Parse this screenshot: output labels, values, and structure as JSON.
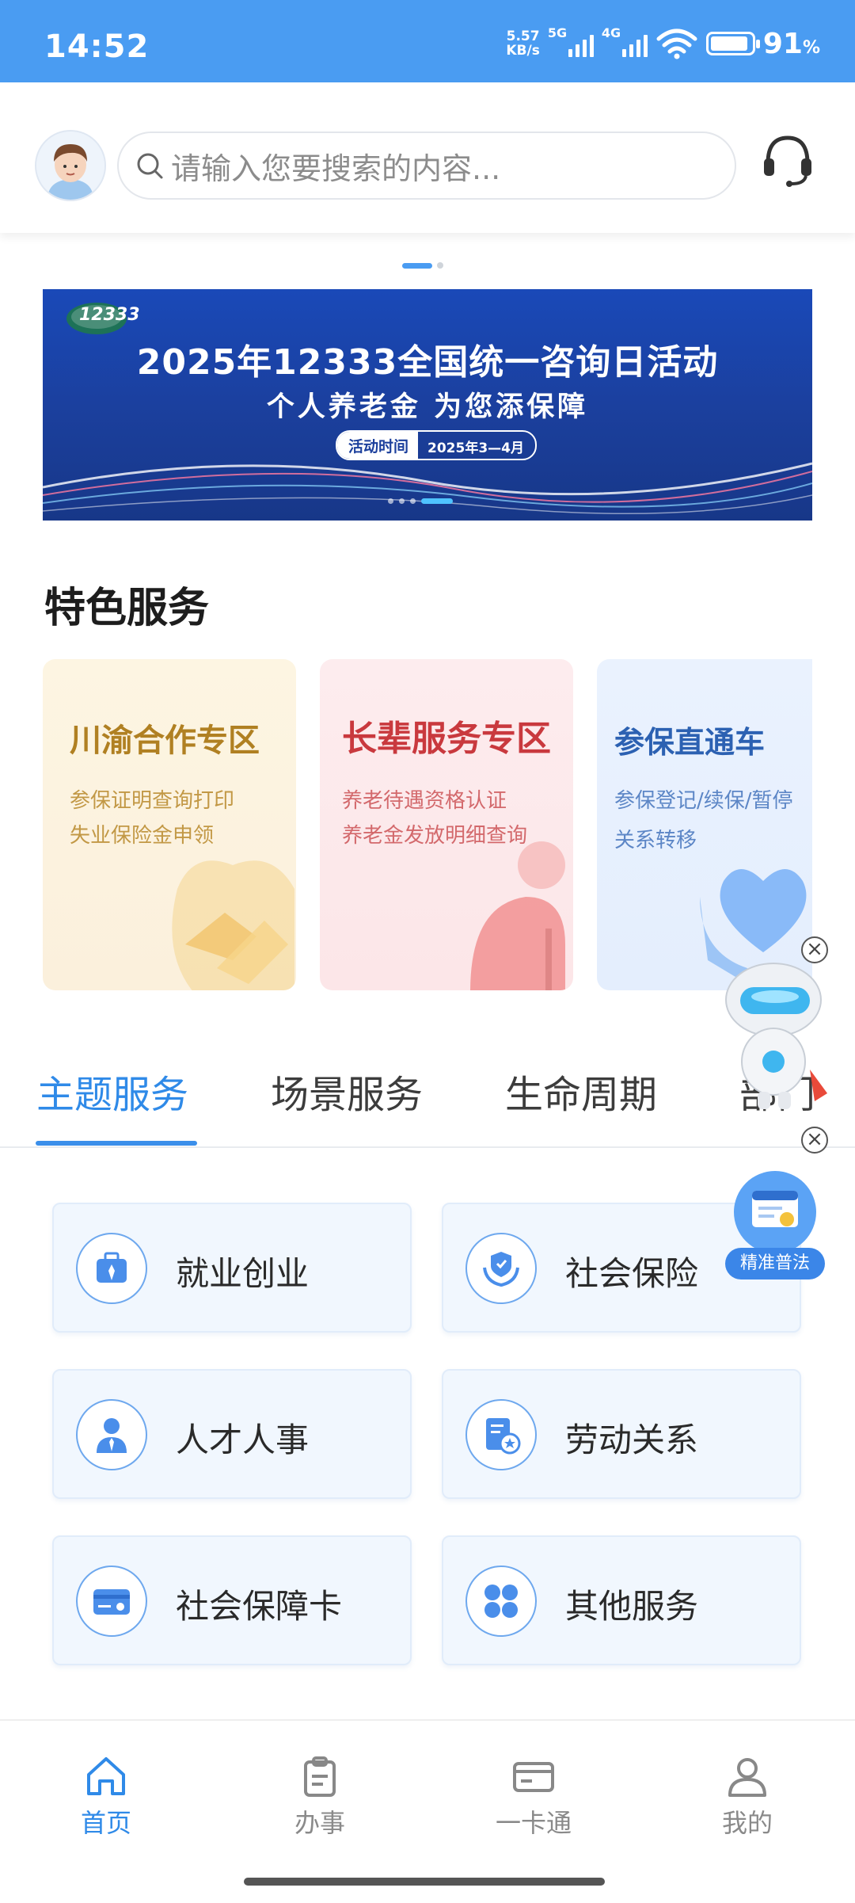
{
  "status_bar": {
    "time": "14:52",
    "net_speed_value": "5.57",
    "net_speed_unit": "KB/s",
    "signal1_label": "5G",
    "signal2_label": "4G",
    "battery_percent": "91",
    "battery_symbol": "%",
    "battery_level": 0.91
  },
  "header": {
    "search_placeholder": "请输入您要搜索的内容...",
    "icons": [
      "avatar",
      "search-icon",
      "customer-service-headset-icon"
    ]
  },
  "banner": {
    "logo_text": "12333",
    "title": "2025年12333全国统一咨询日活动",
    "subtitle": "个人养老金  为您添保障",
    "time_label": "活动时间",
    "time_value": "2025年3—4月"
  },
  "featured": {
    "title": "特色服务",
    "cards": [
      {
        "title": "川渝合作专区",
        "lines": [
          "参保证明查询打印",
          "失业保险金申领"
        ]
      },
      {
        "title": "长辈服务专区",
        "lines": [
          "养老待遇资格认证",
          "养老金发放明细查询"
        ]
      },
      {
        "title": "参保直通车",
        "lines": [
          "参保登记/续保/暂停",
          "关系转移"
        ]
      }
    ]
  },
  "tabs": [
    "主题服务",
    "场景服务",
    "生命周期",
    "部门"
  ],
  "services": [
    {
      "label": "就业创业",
      "icon": "briefcase-icon"
    },
    {
      "label": "社会保险",
      "icon": "shield-hands-icon"
    },
    {
      "label": "人才人事",
      "icon": "person-tie-icon"
    },
    {
      "label": "劳动关系",
      "icon": "document-badge-icon"
    },
    {
      "label": "社会保障卡",
      "icon": "card-icon"
    },
    {
      "label": "其他服务",
      "icon": "grid-icon"
    }
  ],
  "floating": {
    "law_label": "精准普法",
    "close_symbol": "×"
  },
  "bottom_nav": [
    {
      "label": "首页",
      "icon": "home-icon"
    },
    {
      "label": "办事",
      "icon": "clipboard-icon"
    },
    {
      "label": "一卡通",
      "icon": "card-icon"
    },
    {
      "label": "我的",
      "icon": "user-icon"
    }
  ],
  "colors": {
    "primary": "#4a9cf2",
    "active": "#2f8ae8"
  }
}
